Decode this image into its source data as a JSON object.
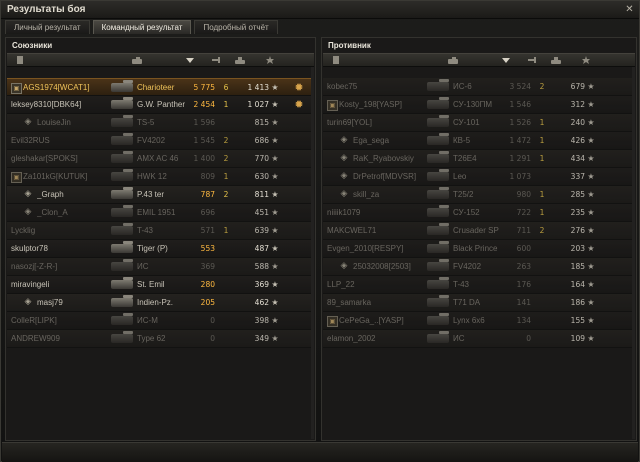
{
  "window": {
    "title": "Результаты боя",
    "close_glyph": "✕"
  },
  "tabs": [
    {
      "label": "Личный результат",
      "active": false
    },
    {
      "label": "Командный результат",
      "active": true
    },
    {
      "label": "Подробный отчёт",
      "active": false
    }
  ],
  "header_icons": [
    "player-icon",
    "tank-icon",
    "sort-arrow-icon",
    "damage-icon",
    "kills-icon",
    "xp-star-icon"
  ],
  "allies": {
    "title": "Союзники",
    "players": [
      {
        "icon": "clan",
        "name": "AGS1974[WCAT1]",
        "vehicle": "Charioteer",
        "damage": "5 775",
        "kills": "6",
        "xp": "1 413",
        "medal": true,
        "self": true,
        "dead": false,
        "gold": true
      },
      {
        "icon": "",
        "name": "leksey8310[DBK64]",
        "vehicle": "G.W. Panther",
        "damage": "2 454",
        "kills": "1",
        "xp": "1 027",
        "medal": true,
        "self": false,
        "dead": false,
        "gold": true
      },
      {
        "icon": "badge",
        "name": "LouiseJin",
        "vehicle": "TS-5",
        "damage": "1 596",
        "kills": "",
        "xp": "815",
        "medal": false,
        "self": false,
        "dead": true,
        "gold": false
      },
      {
        "icon": "",
        "name": "Evil32RUS",
        "vehicle": "FV4202",
        "damage": "1 545",
        "kills": "2",
        "xp": "686",
        "medal": false,
        "self": false,
        "dead": true,
        "gold": false
      },
      {
        "icon": "",
        "name": "gleshakar[SPOKS]",
        "vehicle": "AMX AC 46",
        "damage": "1 400",
        "kills": "2",
        "xp": "770",
        "medal": false,
        "self": false,
        "dead": true,
        "gold": false
      },
      {
        "icon": "clan",
        "name": "Za101kG[KUTUK]",
        "vehicle": "HWK 12",
        "damage": "809",
        "kills": "1",
        "xp": "630",
        "medal": false,
        "self": false,
        "dead": true,
        "gold": false
      },
      {
        "icon": "badge",
        "name": "_Graph",
        "vehicle": "P.43 ter",
        "damage": "787",
        "kills": "2",
        "xp": "811",
        "medal": false,
        "self": false,
        "dead": false,
        "gold": true
      },
      {
        "icon": "badge",
        "name": "_Clon_A",
        "vehicle": "EMIL 1951",
        "damage": "696",
        "kills": "",
        "xp": "451",
        "medal": false,
        "self": false,
        "dead": true,
        "gold": false
      },
      {
        "icon": "",
        "name": "Lycklig",
        "vehicle": "T-43",
        "damage": "571",
        "kills": "1",
        "xp": "639",
        "medal": false,
        "self": false,
        "dead": true,
        "gold": false
      },
      {
        "icon": "",
        "name": "skulptor78",
        "vehicle": "Tiger (P)",
        "damage": "553",
        "kills": "",
        "xp": "487",
        "medal": false,
        "self": false,
        "dead": false,
        "gold": true
      },
      {
        "icon": "",
        "name": "nasozj[-Z-R-]",
        "vehicle": "ИС",
        "damage": "369",
        "kills": "",
        "xp": "588",
        "medal": false,
        "self": false,
        "dead": true,
        "gold": false
      },
      {
        "icon": "",
        "name": "miravingeli",
        "vehicle": "St. Emil",
        "damage": "280",
        "kills": "",
        "xp": "369",
        "medal": false,
        "self": false,
        "dead": false,
        "gold": true
      },
      {
        "icon": "badge",
        "name": "masj79",
        "vehicle": "Indien-Pz.",
        "damage": "205",
        "kills": "",
        "xp": "462",
        "medal": false,
        "self": false,
        "dead": false,
        "gold": true
      },
      {
        "icon": "",
        "name": "ColleR[LIPK]",
        "vehicle": "ИС-М",
        "damage": "0",
        "kills": "",
        "xp": "398",
        "medal": false,
        "self": false,
        "dead": true,
        "gold": false
      },
      {
        "icon": "",
        "name": "ANDREW909",
        "vehicle": "Type 62",
        "damage": "0",
        "kills": "",
        "xp": "349",
        "medal": false,
        "self": false,
        "dead": true,
        "gold": false
      }
    ]
  },
  "enemies": {
    "title": "Противник",
    "players": [
      {
        "icon": "",
        "name": "kobec75",
        "vehicle": "ИС-6",
        "damage": "3 524",
        "kills": "2",
        "xp": "679",
        "dead": true
      },
      {
        "icon": "clan",
        "name": "Kosty_198[YASP]",
        "vehicle": "СУ-130ПМ",
        "damage": "1 546",
        "kills": "",
        "xp": "312",
        "dead": true
      },
      {
        "icon": "",
        "name": "turin69[YOL]",
        "vehicle": "СУ-101",
        "damage": "1 526",
        "kills": "1",
        "xp": "240",
        "dead": true
      },
      {
        "icon": "badge",
        "name": "Ega_sega",
        "vehicle": "КВ-5",
        "damage": "1 472",
        "kills": "1",
        "xp": "426",
        "dead": true
      },
      {
        "icon": "badge",
        "name": "RaK_Ryabovskiy",
        "vehicle": "T26E4",
        "damage": "1 291",
        "kills": "1",
        "xp": "434",
        "dead": true
      },
      {
        "icon": "badge",
        "name": "DrPetrof[MDVSR]",
        "vehicle": "Leo",
        "damage": "1 073",
        "kills": "",
        "xp": "337",
        "dead": true
      },
      {
        "icon": "badge",
        "name": "skill_za",
        "vehicle": "T25/2",
        "damage": "980",
        "kills": "1",
        "xp": "285",
        "dead": true
      },
      {
        "icon": "",
        "name": "niiiik1079",
        "vehicle": "СУ-152",
        "damage": "722",
        "kills": "1",
        "xp": "235",
        "dead": true
      },
      {
        "icon": "",
        "name": "MAKCWEL71",
        "vehicle": "Crusader SP",
        "damage": "711",
        "kills": "2",
        "xp": "276",
        "dead": true
      },
      {
        "icon": "",
        "name": "Evgen_2010[RESPY]",
        "vehicle": "Black Prince",
        "damage": "600",
        "kills": "",
        "xp": "203",
        "dead": true
      },
      {
        "icon": "badge",
        "name": "25032008[2503]",
        "vehicle": "FV4202",
        "damage": "263",
        "kills": "",
        "xp": "185",
        "dead": true
      },
      {
        "icon": "",
        "name": "LLP_22",
        "vehicle": "T-43",
        "damage": "176",
        "kills": "",
        "xp": "164",
        "dead": true
      },
      {
        "icon": "",
        "name": "89_samarka",
        "vehicle": "T71 DA",
        "damage": "141",
        "kills": "",
        "xp": "186",
        "dead": true
      },
      {
        "icon": "clan",
        "name": "CePeGa_..[YASP]",
        "vehicle": "Lynx 6x6",
        "damage": "134",
        "kills": "",
        "xp": "155",
        "dead": true
      },
      {
        "icon": "",
        "name": "elamon_2002",
        "vehicle": "ИС",
        "damage": "0",
        "kills": "",
        "xp": "109",
        "dead": true
      }
    ]
  },
  "glyphs": {
    "star": "★",
    "medal": "✹",
    "clan": "▣",
    "badge": "◈"
  }
}
